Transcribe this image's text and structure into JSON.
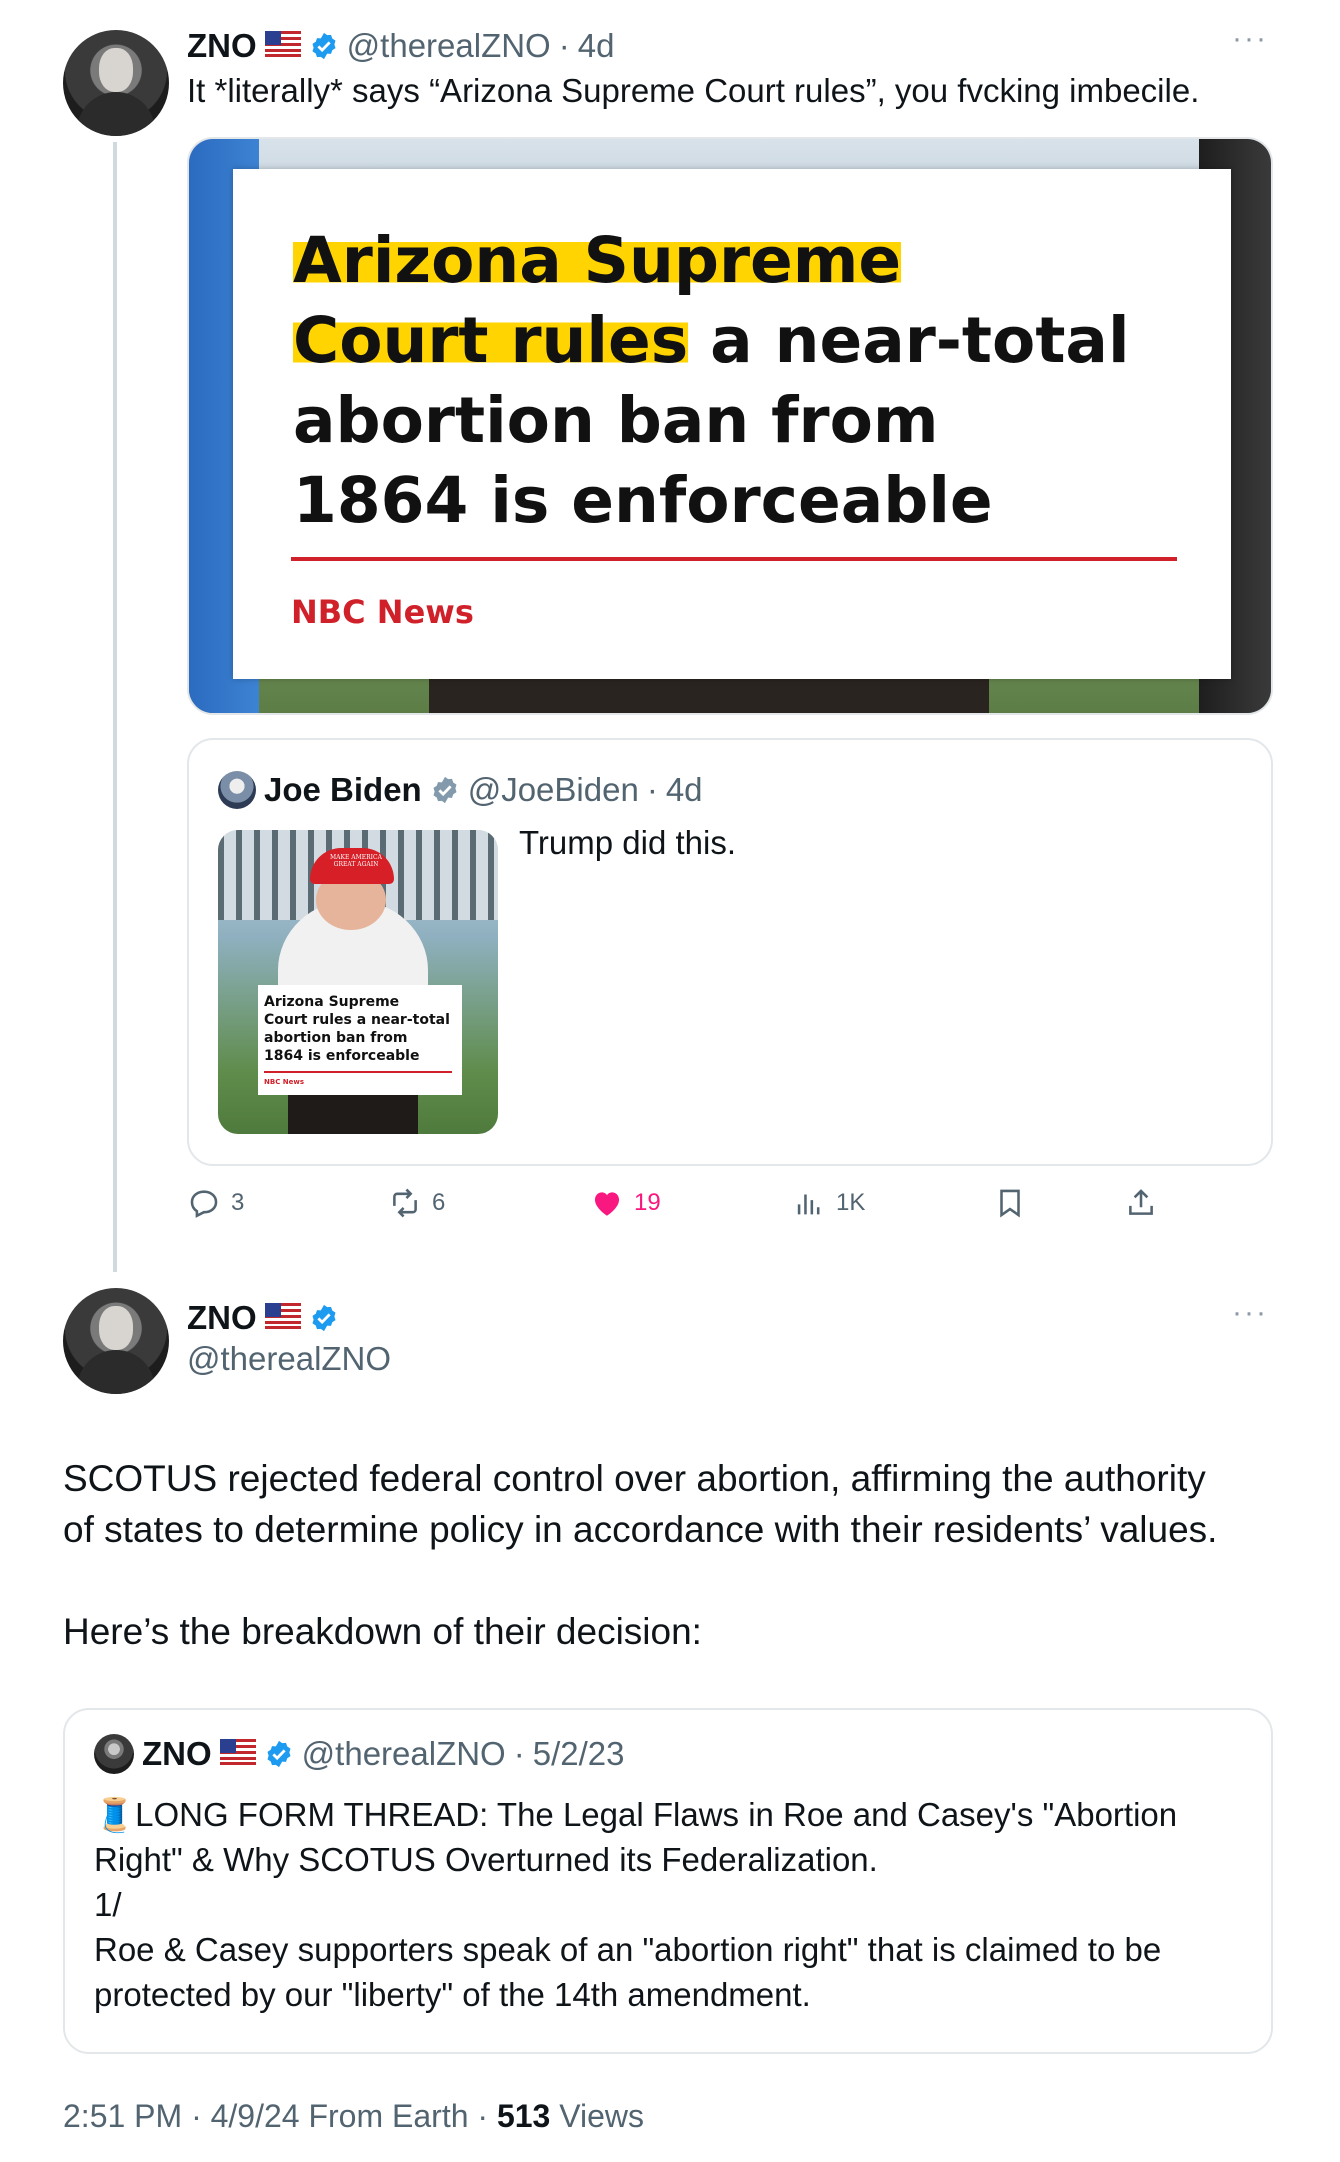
{
  "reply_tweet": {
    "name": "ZNO",
    "flag": "🇺🇸",
    "handle": "@therealZNO",
    "sep": "·",
    "time": "4d",
    "text": "It *literally* says “Arizona Supreme Court rules”, you fvcking imbecile.",
    "media": {
      "headline_highlight_1": "Arizona Supreme",
      "headline_highlight_2": "Court rules",
      "headline_rest_1": " a near-total",
      "headline_line_3": "abortion ban from",
      "headline_line_4": "1864 is enforceable",
      "source": "NBC News"
    },
    "quoted": {
      "name": "Joe Biden",
      "handle": "@JoeBiden",
      "sep": "·",
      "time": "4d",
      "text": "Trump did this.",
      "thumb_lines": [
        "Arizona Supreme",
        "Court rules a near-total",
        "abortion ban from",
        "1864 is enforceable"
      ],
      "thumb_source": "NBC News",
      "thumb_hat": "MAKE AMERICA GREAT AGAIN"
    },
    "actions": {
      "replies": "3",
      "reposts": "6",
      "likes": "19",
      "views": "1K"
    },
    "colors": {
      "like": "#f91880",
      "verified": "#1d9bf0",
      "highlight": "#ffd400",
      "nbc_red": "#d0212b"
    }
  },
  "main_tweet": {
    "name": "ZNO",
    "flag": "🇺🇸",
    "handle": "@therealZNO",
    "para1_line1": "SCOTUS rejected federal control over abortion, affirming the authority",
    "para1_line2": "of states to determine policy in accordance with their residents’ values.",
    "para2": "Here’s the breakdown of their decision:",
    "quoted": {
      "name": "ZNO",
      "flag": "🇺🇸",
      "handle": "@therealZNO",
      "sep": "·",
      "time": "5/2/23",
      "emoji": "🧵",
      "line1": "LONG FORM THREAD: The Legal Flaws in Roe and Casey's \"Abortion",
      "line2": "Right\" & Why SCOTUS Overturned its Federalization.",
      "line3": "1/",
      "line4": "Roe & Casey supporters speak of an \"abortion right\" that is claimed to be",
      "line5": "protected by our \"liberty\" of the 14th amendment."
    },
    "footer": {
      "time": "2:51 PM",
      "date": "4/9/24",
      "sep1": "·",
      "from": "From Earth",
      "sep2": "·",
      "views_count": "513",
      "views_label": "Views"
    }
  }
}
